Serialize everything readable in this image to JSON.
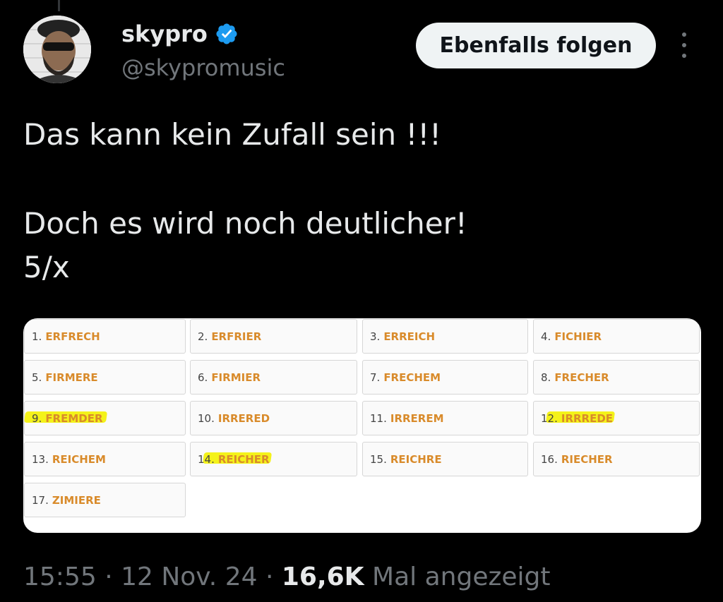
{
  "author": {
    "name": "skypro",
    "handle": "@skypromusic",
    "verified": true
  },
  "follow_button": {
    "label": "Ebenfalls folgen"
  },
  "tweet": {
    "lines": [
      "Das kann kein Zufall sein !!!",
      "Doch es wird noch deutlicher!",
      "5/x"
    ]
  },
  "media": {
    "grid": [
      {
        "num": "1.",
        "word": "ERFRECH",
        "highlighted": false
      },
      {
        "num": "2.",
        "word": "ERFRIER",
        "highlighted": false
      },
      {
        "num": "3.",
        "word": "ERREICH",
        "highlighted": false
      },
      {
        "num": "4.",
        "word": "FICHIER",
        "highlighted": false
      },
      {
        "num": "5.",
        "word": "FIRMERE",
        "highlighted": false
      },
      {
        "num": "6.",
        "word": "FIRMIER",
        "highlighted": false
      },
      {
        "num": "7.",
        "word": "FRECHEM",
        "highlighted": false
      },
      {
        "num": "8.",
        "word": "FRECHER",
        "highlighted": false
      },
      {
        "num": "9.",
        "word": "FREMDER",
        "highlighted": true
      },
      {
        "num": "10.",
        "word": "IRRERED",
        "highlighted": false
      },
      {
        "num": "11.",
        "word": "IRREREM",
        "highlighted": false
      },
      {
        "num": "12.",
        "word": "IRRREDE",
        "highlighted": true
      },
      {
        "num": "13.",
        "word": "REICHEM",
        "highlighted": false
      },
      {
        "num": "14.",
        "word": "REICHER",
        "highlighted": true
      },
      {
        "num": "15.",
        "word": "REICHRE",
        "highlighted": false
      },
      {
        "num": "16.",
        "word": "RIECHER",
        "highlighted": false
      },
      {
        "num": "17.",
        "word": "ZIMIERE",
        "highlighted": false
      }
    ]
  },
  "meta": {
    "time": "15:55",
    "date": "12 Nov. 24",
    "views": "16,6K",
    "views_label": "Mal angezeigt"
  },
  "colors": {
    "background": "#000000",
    "verified_badge": "#1d9bf0",
    "word_color": "#d98b2b",
    "highlight": "#f4f21a"
  }
}
